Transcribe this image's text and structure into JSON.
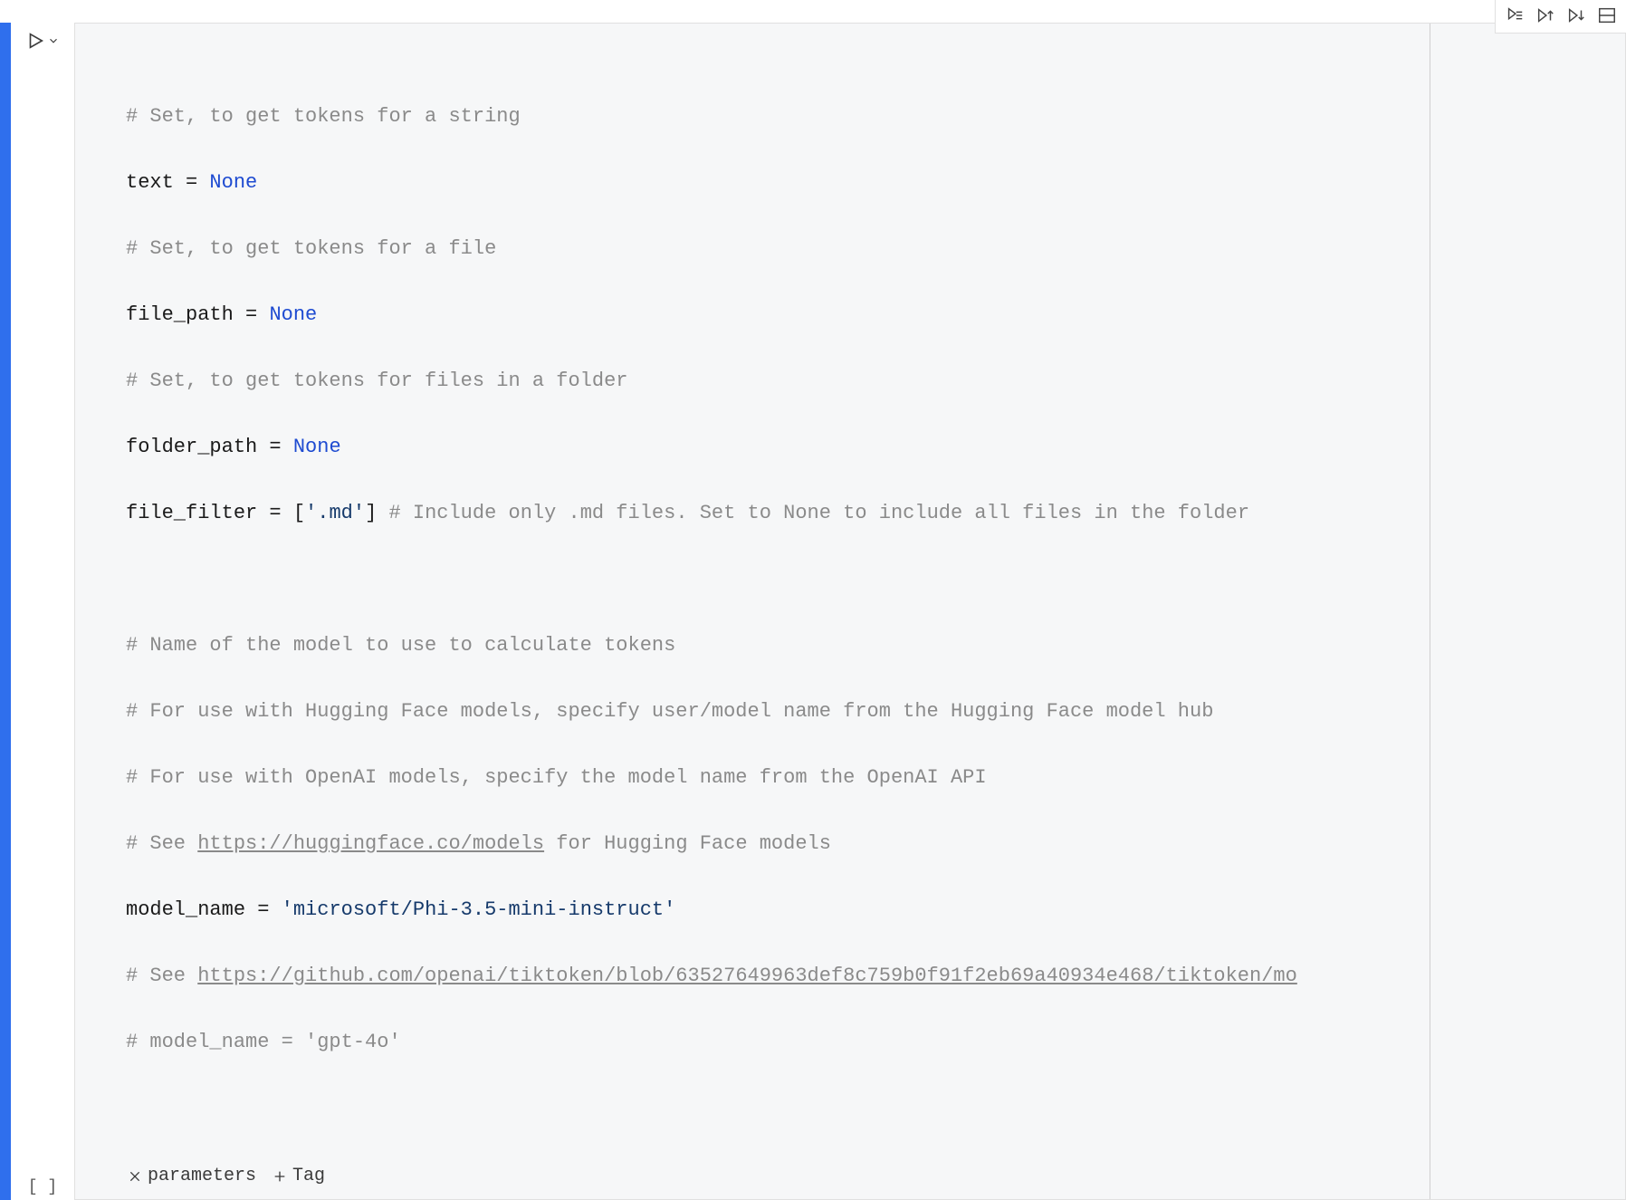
{
  "toolbar": {
    "run_by_line": "Run by line",
    "execute_above": "Execute cells above",
    "execute_below": "Execute cell and below",
    "split": "Split cell"
  },
  "cell": {
    "exec_count": "[ ]",
    "ruler_col": 80
  },
  "code": {
    "l1_comment": "# Set, to get tokens for a string",
    "l2_var": "text",
    "l2_eq": " = ",
    "l2_val": "None",
    "l3_comment": "# Set, to get tokens for a file",
    "l4_var": "file_path",
    "l4_eq": " = ",
    "l4_val": "None",
    "l5_comment": "# Set, to get tokens for files in a folder",
    "l6_var": "folder_path",
    "l6_eq": " = ",
    "l6_val": "None",
    "l7_var": "file_filter",
    "l7_eq": " = ",
    "l7_br_open": "[",
    "l7_str": "'.md'",
    "l7_br_close": "]",
    "l7_trail": " # Include only .md files. Set to None to include all files in the folder",
    "l9_comment": "# Name of the model to use to calculate tokens",
    "l10_comment": "# For use with Hugging Face models, specify user/model name from the Hugging Face model hub",
    "l11_comment": "# For use with OpenAI models, specify the model name from the OpenAI API",
    "l12_prefix": "# See ",
    "l12_link": "https://huggingface.co/models",
    "l12_suffix": " for Hugging Face models",
    "l13_var": "model_name",
    "l13_eq": " = ",
    "l13_str": "'microsoft/Phi-3.5-mini-instruct'",
    "l14_prefix": "# See ",
    "l14_link": "https://github.com/openai/tiktoken/blob/63527649963def8c759b0f91f2eb69a40934e468/tiktoken/mo",
    "l15_comment": "# model_name = 'gpt-4o'"
  },
  "footer": {
    "param_label": "parameters",
    "tag_label": "Tag"
  }
}
